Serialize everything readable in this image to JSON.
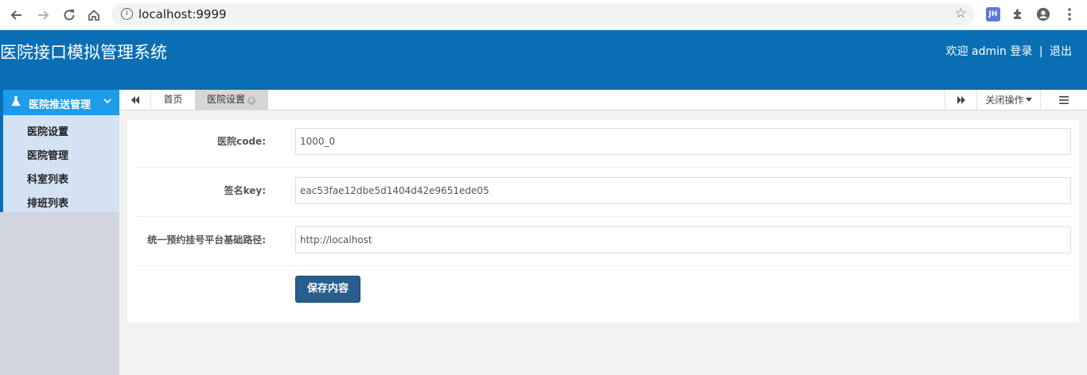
{
  "browser": {
    "url": "localhost:9999",
    "extension_badge": "JH"
  },
  "header": {
    "title": "医院接口模拟管理系统",
    "welcome": "欢迎 admin 登录",
    "separator": "|",
    "logout": "退出",
    "bg_color": "#0a6eb4"
  },
  "sidebar": {
    "group_label": "医院推送管理",
    "items": [
      {
        "label": "医院设置"
      },
      {
        "label": "医院管理"
      },
      {
        "label": "科室列表"
      },
      {
        "label": "排班列表"
      }
    ]
  },
  "tabs": {
    "home": "首页",
    "active": "医院设置",
    "close_ops": "关闭操作"
  },
  "form": {
    "fields": [
      {
        "label": "医院code:",
        "value": "1000_0"
      },
      {
        "label": "签名key:",
        "value": "eac53fae12dbe5d1404d42e9651ede05"
      },
      {
        "label": "统一预约挂号平台基础路径:",
        "value": "http://localhost"
      }
    ],
    "save_label": "保存内容"
  }
}
